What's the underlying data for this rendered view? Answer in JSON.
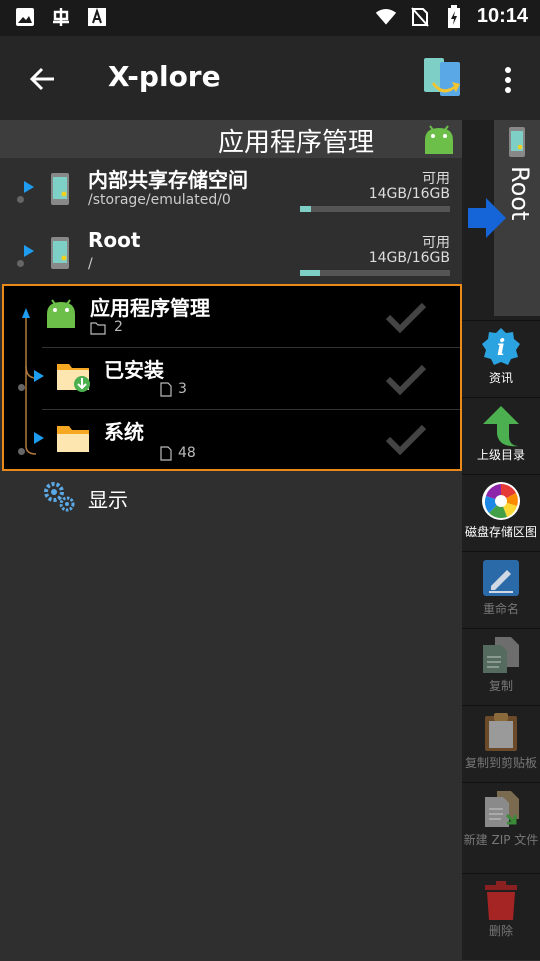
{
  "status_bar": {
    "time": "10:14"
  },
  "app_bar": {
    "title": "X-plore"
  },
  "panel": {
    "title": "应用程序管理",
    "storage_rows": [
      {
        "name": "内部共享存储空间",
        "path": "/storage/emulated/0",
        "avail_label": "可用",
        "size": "14GB/16GB",
        "used_fraction": 0.07
      },
      {
        "name": "Root",
        "path": "/",
        "avail_label": "可用",
        "size": "14GB/16GB",
        "used_fraction": 0.13
      }
    ],
    "tree": {
      "root": {
        "name": "应用程序管理",
        "count": "2"
      },
      "children": [
        {
          "name": "已安装",
          "count": "3"
        },
        {
          "name": "系统",
          "count": "48"
        }
      ]
    },
    "display_item": {
      "name": "显示"
    }
  },
  "right_pane": {
    "root_label": "Root"
  },
  "toolbar": [
    {
      "label": "资讯",
      "icon": "info-icon",
      "enabled": true
    },
    {
      "label": "上级目录",
      "icon": "up-arrow-icon",
      "enabled": true
    },
    {
      "label": "磁盘存储区图",
      "icon": "pie-chart-icon",
      "enabled": true
    },
    {
      "label": "重命名",
      "icon": "rename-icon",
      "enabled": false
    },
    {
      "label": "复制",
      "icon": "copy-icon",
      "enabled": false
    },
    {
      "label": "复制到剪贴板",
      "icon": "clipboard-icon",
      "enabled": false
    },
    {
      "label": "新建 ZIP 文件",
      "icon": "zip-icon",
      "enabled": false
    },
    {
      "label": "删除",
      "icon": "trash-icon",
      "enabled": false
    }
  ],
  "colors": {
    "accent_orange": "#e98a1d",
    "accent_blue": "#1e9cf0",
    "android_green": "#6cc04a",
    "bar_fill": "#7ecfc6"
  }
}
